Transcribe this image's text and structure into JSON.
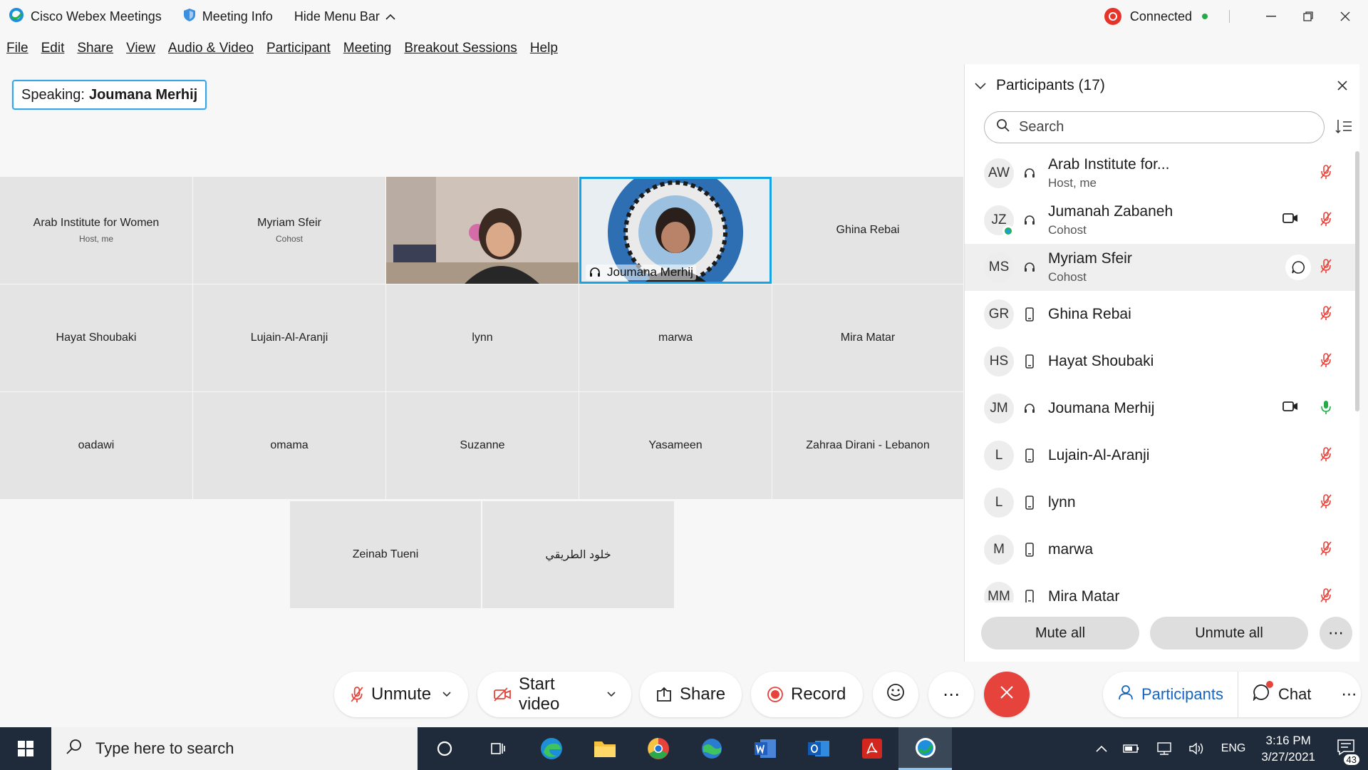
{
  "titlebar": {
    "app_name": "Cisco Webex Meetings",
    "meeting_info": "Meeting Info",
    "hide_menu_bar": "Hide Menu Bar",
    "status": "Connected",
    "colors": {
      "status_red": "#e7342b",
      "status_green": "#25a94a"
    }
  },
  "menu": [
    "File",
    "Edit",
    "Share",
    "View",
    "Audio & Video",
    "Participant",
    "Meeting",
    "Breakout Sessions",
    "Help"
  ],
  "speaking": {
    "label": "Speaking:",
    "name": "Joumana Merhij"
  },
  "grid": {
    "tiles": [
      {
        "name": "Arab Institute for Women",
        "role": "Host, me"
      },
      {
        "name": "Myriam Sfeir",
        "role": "Cohost"
      },
      {
        "name": "",
        "role": "",
        "video": true
      },
      {
        "name": "Joumana Merhij",
        "role": "",
        "video": true,
        "active": true
      },
      {
        "name": "Ghina Rebai",
        "role": ""
      },
      {
        "name": "Hayat Shoubaki",
        "role": ""
      },
      {
        "name": "Lujain-Al-Aranji",
        "role": ""
      },
      {
        "name": "lynn",
        "role": ""
      },
      {
        "name": "marwa",
        "role": ""
      },
      {
        "name": "Mira Matar",
        "role": ""
      },
      {
        "name": "oadawi",
        "role": ""
      },
      {
        "name": "omama",
        "role": ""
      },
      {
        "name": "Suzanne",
        "role": ""
      },
      {
        "name": "Yasameen",
        "role": ""
      },
      {
        "name": "Zahraa Dirani - Lebanon",
        "role": ""
      },
      {
        "name": "Zeinab Tueni",
        "role": ""
      },
      {
        "name": "خلود الطريقي",
        "role": ""
      }
    ]
  },
  "participants_panel": {
    "title": "Participants (17)",
    "search_placeholder": "Search",
    "items": [
      {
        "initials": "AW",
        "name": "Arab Institute for...",
        "role": "Host, me",
        "device": "headset",
        "mic": "muted"
      },
      {
        "initials": "JZ",
        "name": "Jumanah Zabaneh",
        "role": "Cohost",
        "device": "headset",
        "mic": "muted",
        "camera": true,
        "badge": true
      },
      {
        "initials": "MS",
        "name": "Myriam Sfeir",
        "role": "Cohost",
        "device": "headset",
        "mic": "muted",
        "chat": true,
        "highlighted": true
      },
      {
        "initials": "GR",
        "name": "Ghina Rebai",
        "role": "",
        "device": "phone",
        "mic": "muted"
      },
      {
        "initials": "HS",
        "name": "Hayat Shoubaki",
        "role": "",
        "device": "phone",
        "mic": "muted"
      },
      {
        "initials": "JM",
        "name": "Joumana Merhij",
        "role": "",
        "device": "headset",
        "mic": "active",
        "camera": true
      },
      {
        "initials": "L",
        "name": "Lujain-Al-Aranji",
        "role": "",
        "device": "phone",
        "mic": "muted"
      },
      {
        "initials": "L",
        "name": "lynn",
        "role": "",
        "device": "phone",
        "mic": "muted"
      },
      {
        "initials": "M",
        "name": "marwa",
        "role": "",
        "device": "phone",
        "mic": "muted"
      },
      {
        "initials": "MM",
        "name": "Mira Matar",
        "role": "",
        "device": "phone",
        "mic": "muted"
      }
    ],
    "mute_all": "Mute all",
    "unmute_all": "Unmute all"
  },
  "controls": {
    "unmute": "Unmute",
    "start_video": "Start video",
    "share": "Share",
    "record": "Record",
    "participants": "Participants",
    "chat": "Chat",
    "colors": {
      "leave": "#e5433b",
      "accent": "#1664c0"
    }
  },
  "taskbar": {
    "search_placeholder": "Type here to search",
    "language": "ENG",
    "time": "3:16 PM",
    "date": "3/27/2021",
    "notifications": "43"
  }
}
